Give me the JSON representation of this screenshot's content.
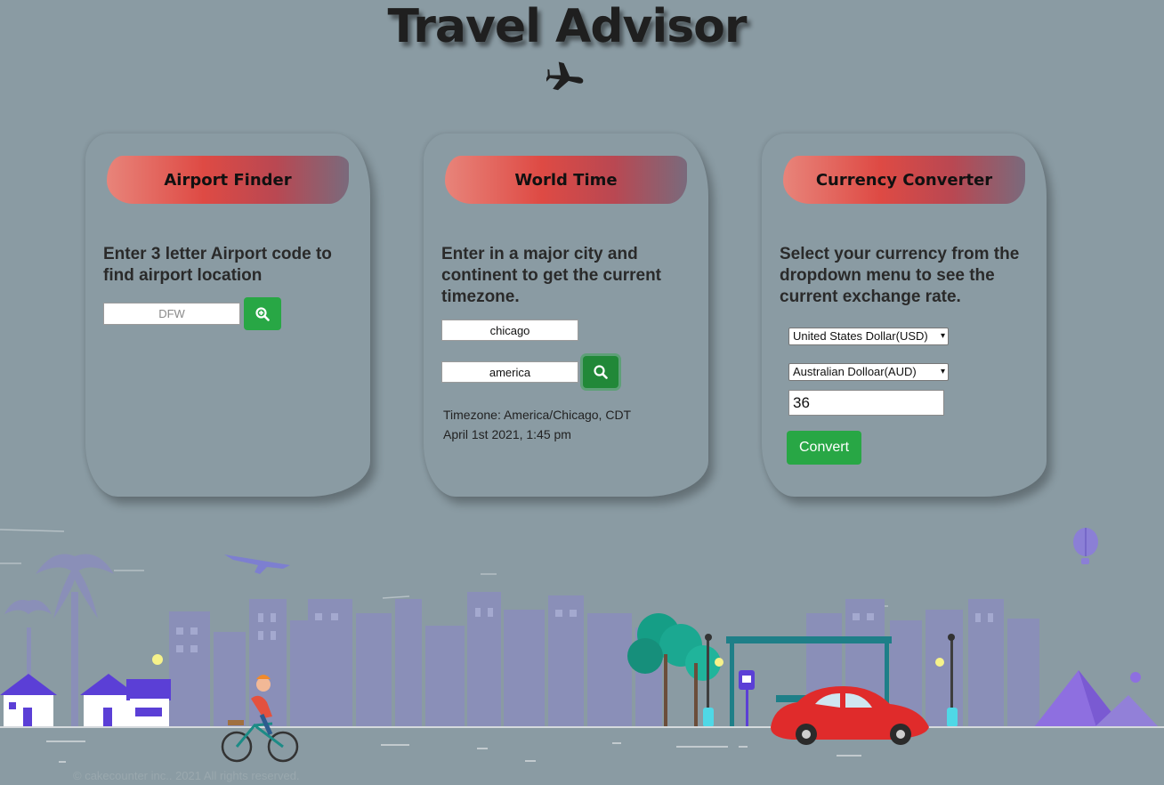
{
  "site": {
    "title": "Travel Advisor",
    "title_icon": "airplane-icon"
  },
  "airport_finder": {
    "title": "Airport Finder",
    "description": "Enter 3 letter Airport code to find airport location",
    "code_placeholder": "DFW",
    "code_value": "",
    "search_icon": "zoom-in-icon"
  },
  "world_time": {
    "title": "World Time",
    "description": "Enter in a major city and continent to get the current timezone.",
    "city_value": "chicago",
    "continent_value": "america",
    "search_icon": "search-icon",
    "result_timezone": "Timezone: America/Chicago, CDT",
    "result_datetime": "April 1st 2021, 1:45 pm"
  },
  "currency_converter": {
    "title": "Currency Converter",
    "description": "Select your currency from the dropdown menu to see the current exchange rate.",
    "from_currency": "United States Dollar(USD)",
    "to_currency": "Australian Dolloar(AUD)",
    "amount": "36",
    "convert_label": "Convert"
  },
  "footer": {
    "copyright": "© cakecounter inc.. 2021 All rights reserved."
  },
  "colors": {
    "background": "#8a9ba3",
    "header_gradient_start": "#e8847a",
    "header_gradient_mid": "#de4a44",
    "header_gradient_end": "#7a6a7c",
    "button_green": "#28a745",
    "city_silhouette": "#8a8fb8",
    "car_red": "#e02b2b",
    "house_purple": "#5b3fd6"
  }
}
